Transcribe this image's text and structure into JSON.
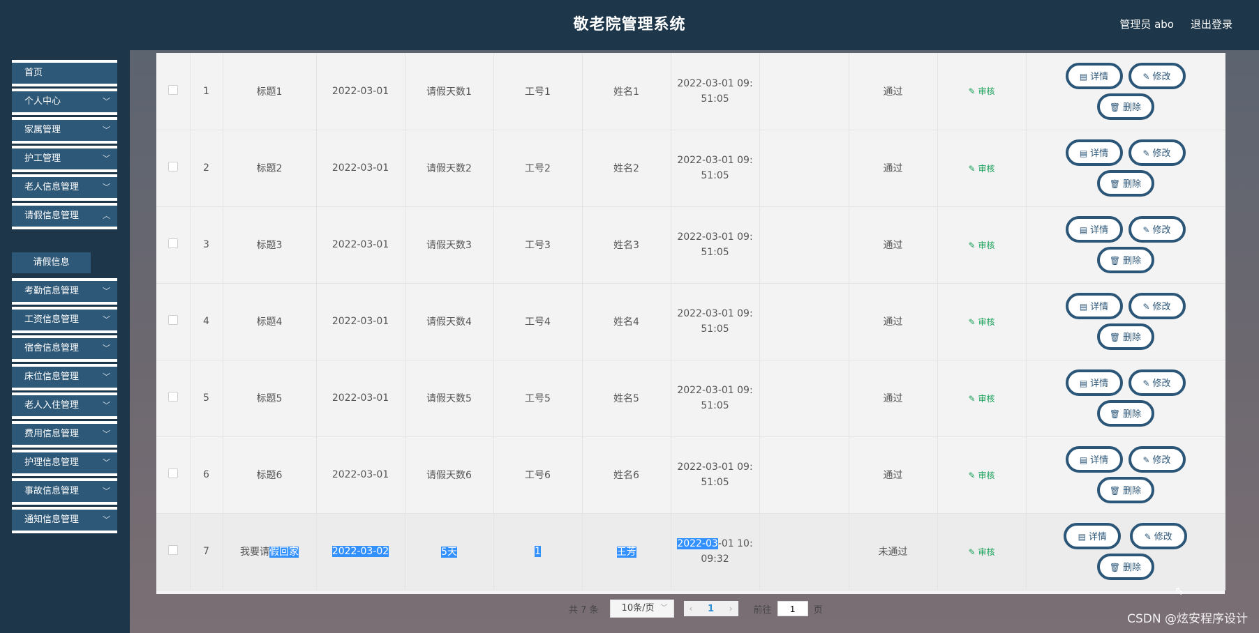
{
  "header": {
    "title": "敬老院管理系统",
    "user": "管理员 abo",
    "logout": "退出登录"
  },
  "sidebar": {
    "items": [
      {
        "label": "首页"
      },
      {
        "label": "个人中心"
      },
      {
        "label": "家属管理"
      },
      {
        "label": "护工管理"
      },
      {
        "label": "老人信息管理"
      },
      {
        "label": "请假信息管理"
      },
      {
        "label": "考勤信息管理"
      },
      {
        "label": "工资信息管理"
      },
      {
        "label": "宿舍信息管理"
      },
      {
        "label": "床位信息管理"
      },
      {
        "label": "老人入住管理"
      },
      {
        "label": "费用信息管理"
      },
      {
        "label": "护理信息管理"
      },
      {
        "label": "事故信息管理"
      },
      {
        "label": "通知信息管理"
      }
    ],
    "submenu": {
      "label": "请假信息"
    }
  },
  "table": {
    "rows": [
      {
        "index": "1",
        "title": "标题1",
        "date": "2022-03-01",
        "days": "请假天数1",
        "job_no": "工号1",
        "name": "姓名1",
        "time": "2022-03-01 09:51:05",
        "status": "通过",
        "audit": "审核"
      },
      {
        "index": "2",
        "title": "标题2",
        "date": "2022-03-01",
        "days": "请假天数2",
        "job_no": "工号2",
        "name": "姓名2",
        "time": "2022-03-01 09:51:05",
        "status": "通过",
        "audit": "审核"
      },
      {
        "index": "3",
        "title": "标题3",
        "date": "2022-03-01",
        "days": "请假天数3",
        "job_no": "工号3",
        "name": "姓名3",
        "time": "2022-03-01 09:51:05",
        "status": "通过",
        "audit": "审核"
      },
      {
        "index": "4",
        "title": "标题4",
        "date": "2022-03-01",
        "days": "请假天数4",
        "job_no": "工号4",
        "name": "姓名4",
        "time": "2022-03-01 09:51:05",
        "status": "通过",
        "audit": "审核"
      },
      {
        "index": "5",
        "title": "标题5",
        "date": "2022-03-01",
        "days": "请假天数5",
        "job_no": "工号5",
        "name": "姓名5",
        "time": "2022-03-01 09:51:05",
        "status": "通过",
        "audit": "审核"
      },
      {
        "index": "6",
        "title": "标题6",
        "date": "2022-03-01",
        "days": "请假天数6",
        "job_no": "工号6",
        "name": "姓名6",
        "time": "2022-03-01 09:51:05",
        "status": "通过",
        "audit": "审核"
      }
    ],
    "last_row": {
      "index": "7",
      "title_a": "我要请",
      "title_b": "假回家",
      "date": "2022-03-02",
      "days": "5天",
      "job_no": "1",
      "name": "王芳",
      "time_a": "2022-03",
      "time_b": "-01 10:09:32",
      "status": "未通过",
      "audit": "审核"
    },
    "actions": {
      "detail": "详情",
      "edit": "修改",
      "delete": "删除"
    }
  },
  "pagination": {
    "total": "共 7 条",
    "page_size": "10条/页",
    "current_page": "1",
    "goto_label": "前往",
    "goto_value": "1",
    "page_unit": "页"
  },
  "watermark": "CSDN @炫安程序设计"
}
